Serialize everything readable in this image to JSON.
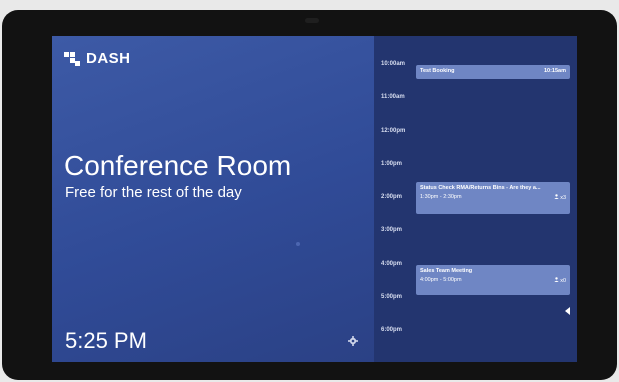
{
  "brand": {
    "logo_text": "DASH"
  },
  "room": {
    "name": "Conference Room",
    "status": "Free for the rest of the day"
  },
  "clock": {
    "time": "5:25 PM"
  },
  "schedule": {
    "hours": [
      "10:00am",
      "11:00am",
      "12:00pm",
      "1:00pm",
      "2:00pm",
      "3:00pm",
      "4:00pm",
      "5:00pm",
      "6:00pm"
    ],
    "events": [
      {
        "title": "Test Booking",
        "time": "10:15am"
      },
      {
        "title": "Status Check RMA/Returns Bins - Are they a...",
        "time": "1:30pm - 2:30pm",
        "attendees": "x3"
      },
      {
        "title": "Sales Team Meeting",
        "time": "4:00pm - 5:00pm",
        "attendees": "x0"
      }
    ]
  },
  "colors": {
    "left_panel": "#3d5aa6",
    "right_panel": "#23356f",
    "event_block": "#6f86c4",
    "device_bezel": "#121212"
  },
  "icons": [
    "dash-logo-icon",
    "gear-icon",
    "person-icon",
    "chevron-left-icon"
  ]
}
